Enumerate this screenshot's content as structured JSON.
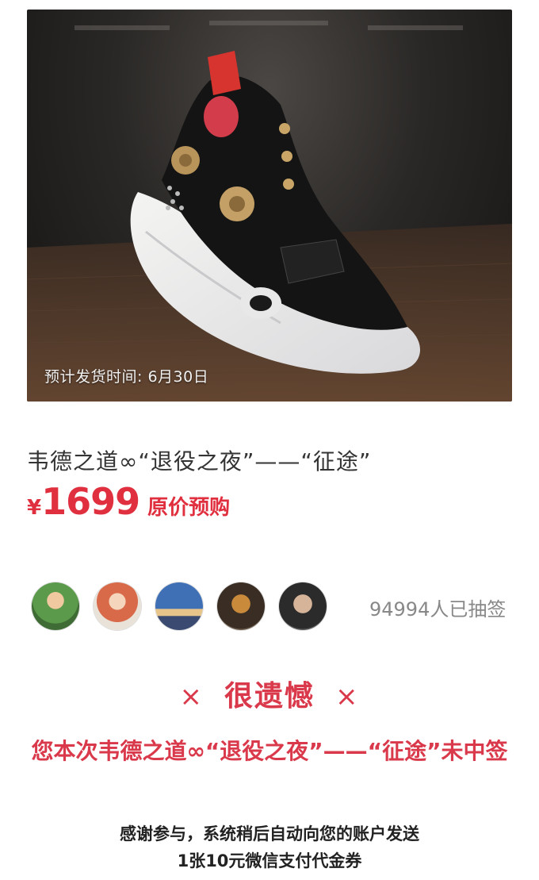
{
  "product": {
    "ship_date": "预计发货时间: 6月30日",
    "title": "韦德之道∞“退役之夜”——“征途”",
    "price_currency": "¥",
    "price_amount": "1699",
    "price_tag": "原价预购"
  },
  "participants": {
    "avatars": [
      "avatar-1",
      "avatar-2",
      "avatar-3",
      "avatar-4",
      "avatar-5"
    ],
    "count_text": "94994人已抽签"
  },
  "result": {
    "x_left": "×",
    "headline": "很遗憾",
    "x_right": "×",
    "message": "您本次韦德之道∞“退役之夜”——“征途”未中签",
    "thanks_line1": "感谢参与，系统稍后自动向您的账户发送",
    "thanks_line2": "1张10元微信支付代金券"
  },
  "colors": {
    "accent_red": "#e0303f",
    "muted_gray": "#888888"
  }
}
